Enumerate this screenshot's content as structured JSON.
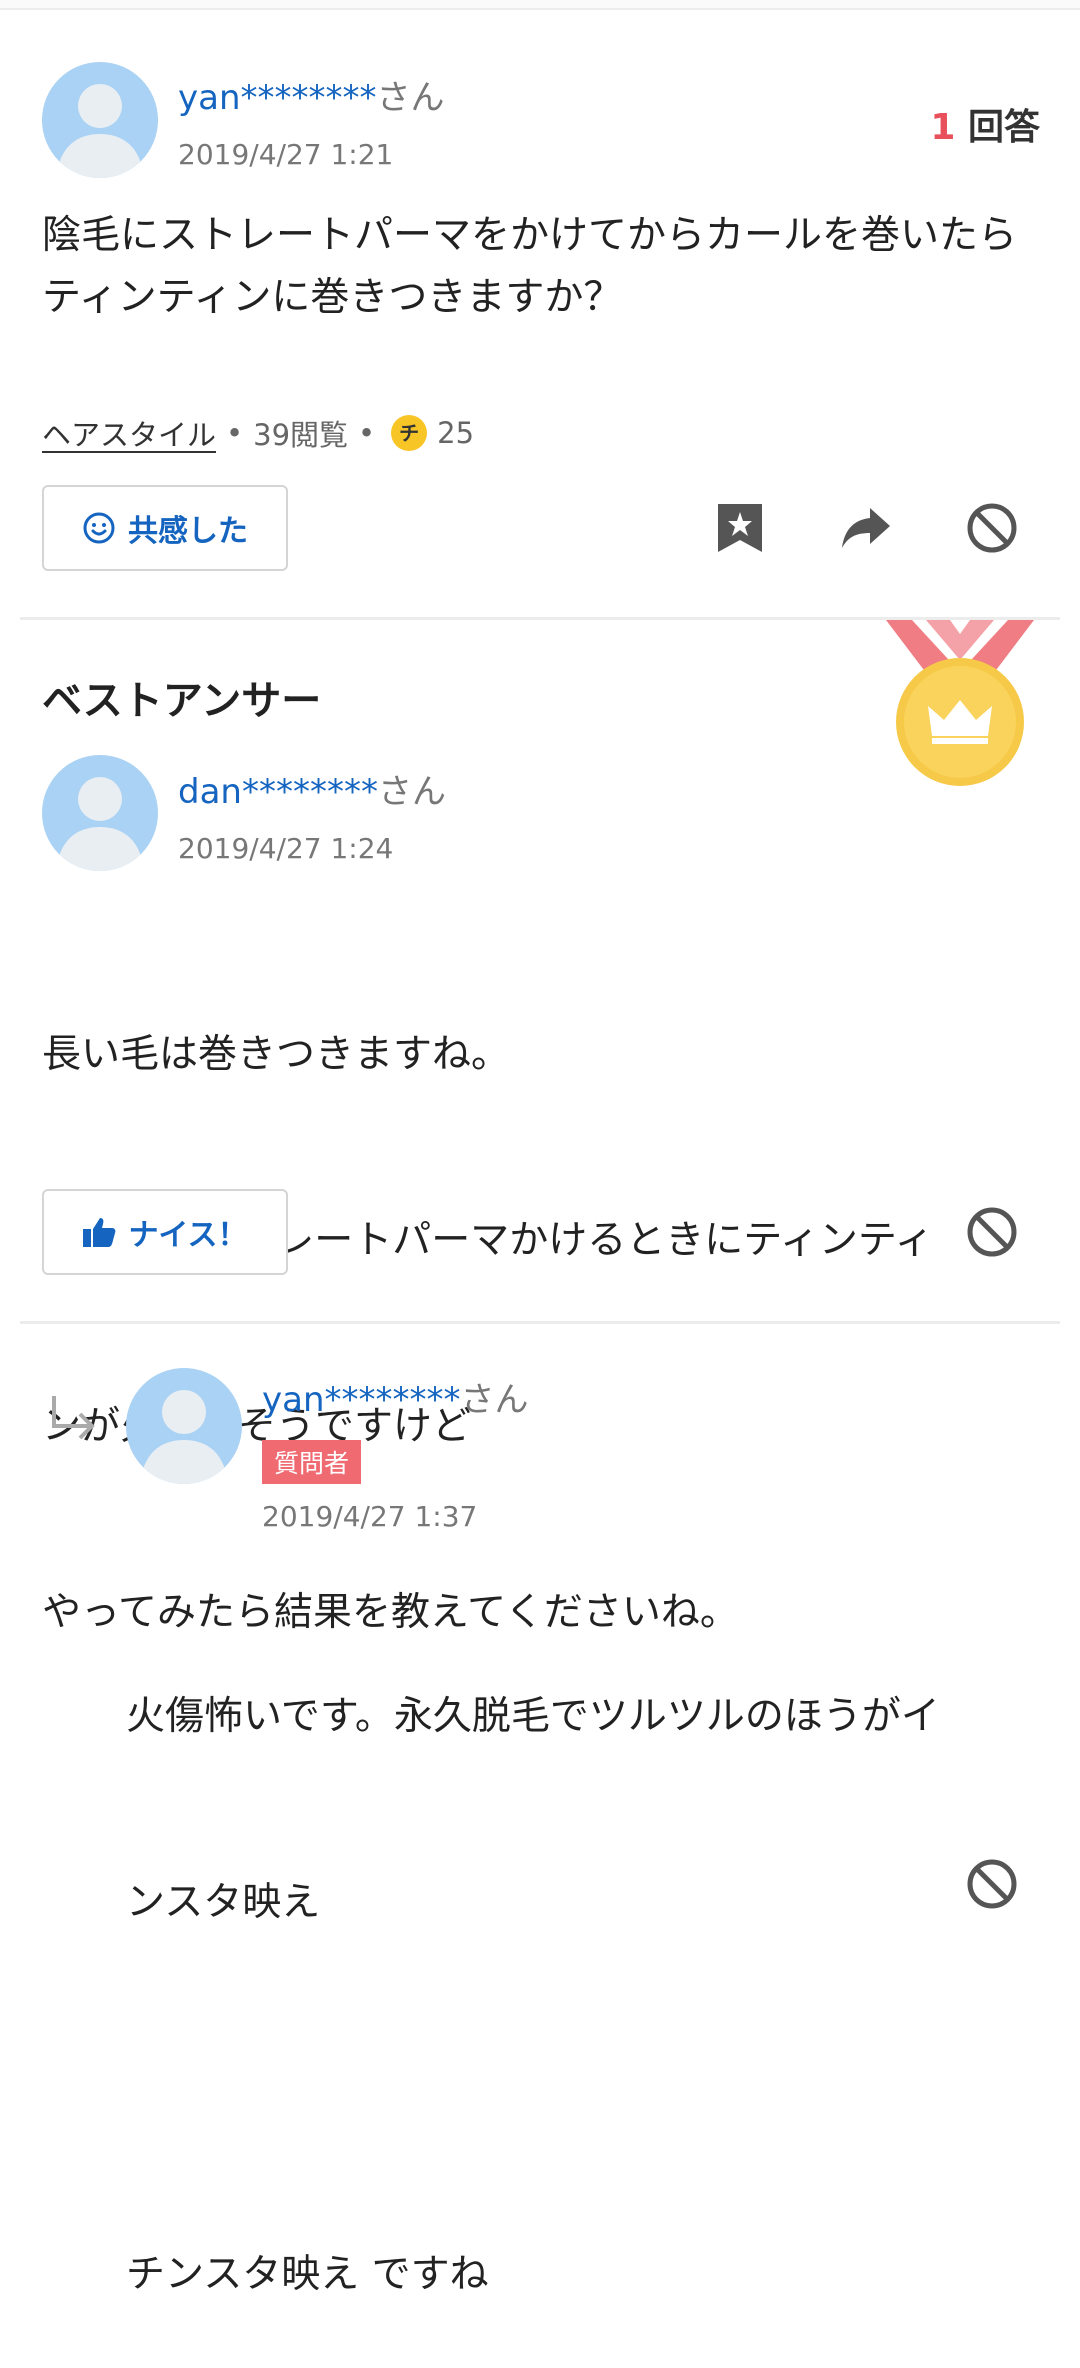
{
  "question": {
    "username": "yan********",
    "honorific": "さん",
    "date": "2019/4/27 1:21",
    "answers_num": "1",
    "answers_label": "回答",
    "text": "陰毛にストレートパーマをかけてからカールを巻いたらティンティンに巻きつきますか？",
    "category": "ヘアスタイル",
    "views": "39閲覧",
    "coin_symbol": "チ",
    "coins": "25",
    "empathy_label": "共感した"
  },
  "best_answer": {
    "section_title": "ベストアンサー",
    "username": "dan********",
    "honorific": "さん",
    "date": "2019/4/27 1:24",
    "lines": [
      "長い毛は巻きつきますね。",
      "ですが、ストレートパーマかけるときにティンティ",
      "ンが火傷しそうですけど",
      "やってみたら結果を教えてくださいね。"
    ],
    "nice_label": "ナイス！"
  },
  "reply": {
    "username": "yan********",
    "honorific": "さん",
    "badge": "質問者",
    "date": "2019/4/27 1:37",
    "lines": [
      "火傷怖いです。永久脱毛でツルツルのほうがイ",
      "ンスタ映え",
      "",
      "チンスタ映え ですね"
    ]
  },
  "icons": {
    "avatar": "avatar-icon",
    "smile": "smile-icon",
    "bookmark": "bookmark-icon",
    "share": "share-icon",
    "block": "block-icon",
    "thumbs_up": "thumbs-up-icon",
    "reply_arrow": "reply-arrow-icon",
    "medal": "medal-icon"
  },
  "colors": {
    "link": "#1565c0",
    "accent_red": "#e8505b",
    "medal_gold": "#f7c948",
    "ribbon": "#f07d83"
  }
}
